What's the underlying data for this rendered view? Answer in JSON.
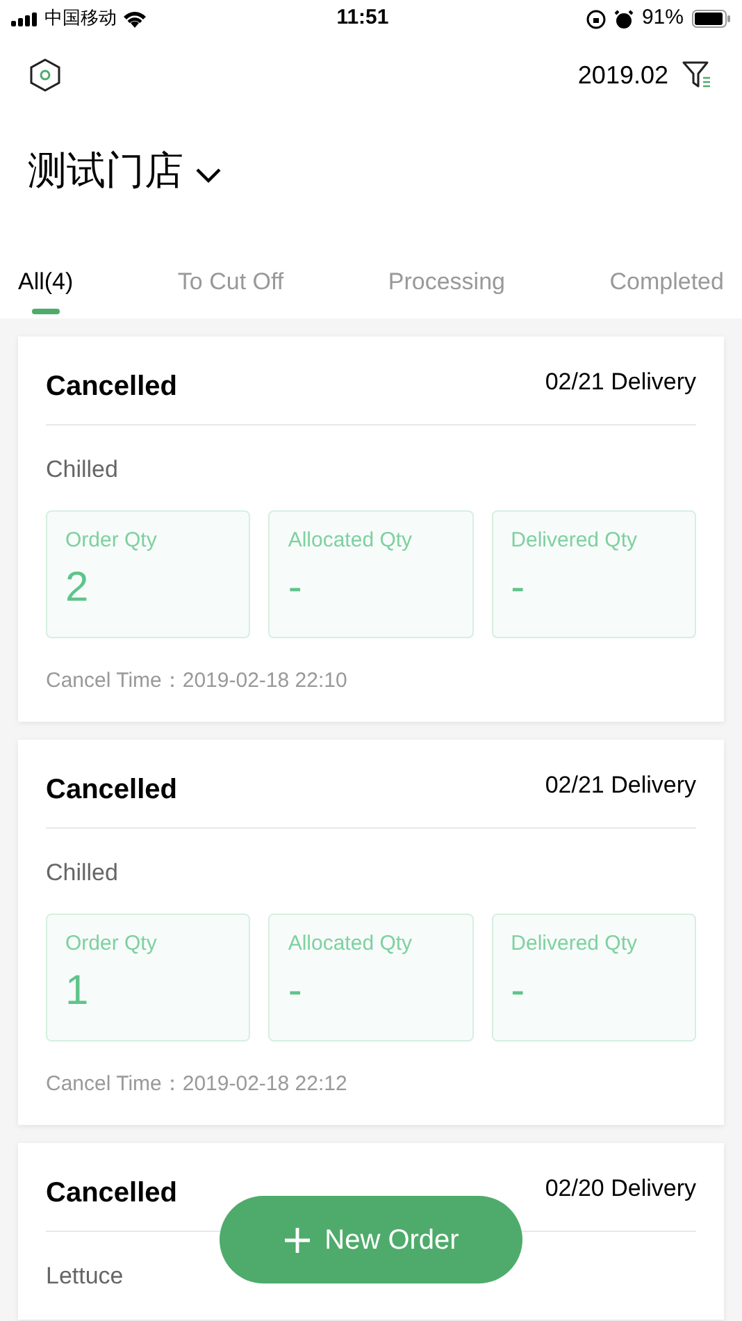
{
  "status_bar": {
    "carrier": "中国移动",
    "time": "11:51",
    "battery": "91%"
  },
  "header": {
    "month": "2019.02"
  },
  "store": {
    "name": "测试门店"
  },
  "tabs": [
    {
      "label": "All(4)",
      "selected": true
    },
    {
      "label": "To Cut Off",
      "selected": false
    },
    {
      "label": "Processing",
      "selected": false
    },
    {
      "label": "Completed",
      "selected": false
    }
  ],
  "orders": [
    {
      "status": "Cancelled",
      "delivery": "02/21 Delivery",
      "category": "Chilled",
      "quantities": [
        {
          "label": "Order Qty",
          "value": "2"
        },
        {
          "label": "Allocated Qty",
          "value": "-"
        },
        {
          "label": "Delivered Qty",
          "value": "-"
        }
      ],
      "cancel_label": "Cancel Time：",
      "cancel_time": "2019-02-18 22:10"
    },
    {
      "status": "Cancelled",
      "delivery": "02/21 Delivery",
      "category": "Chilled",
      "quantities": [
        {
          "label": "Order Qty",
          "value": "1"
        },
        {
          "label": "Allocated Qty",
          "value": "-"
        },
        {
          "label": "Delivered Qty",
          "value": "-"
        }
      ],
      "cancel_label": "Cancel Time：",
      "cancel_time": "2019-02-18 22:12"
    },
    {
      "status": "Cancelled",
      "delivery": "02/20 Delivery",
      "category": "Lettuce"
    }
  ],
  "new_order_button": {
    "label": "New Order"
  }
}
